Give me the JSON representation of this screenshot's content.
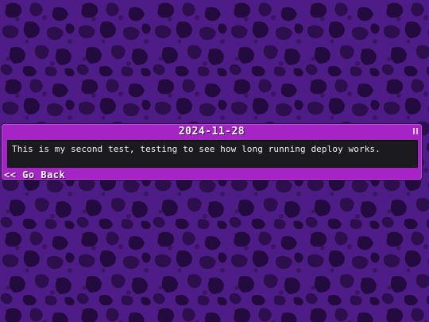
{
  "entry": {
    "date": "2024-11-28",
    "message": "This is my second test, testing to see how long running deploy works."
  },
  "navigation": {
    "back_label": "<< Go Back"
  },
  "icons": {
    "window_control": "pause-icon"
  },
  "colors": {
    "background": "#4a1a7e",
    "pattern_spot": "#2a0f48",
    "pattern_ring": "#3a1560",
    "window_accent": "#a623c6",
    "content_bg": "#1b1a1f",
    "text": "#ffffff"
  }
}
